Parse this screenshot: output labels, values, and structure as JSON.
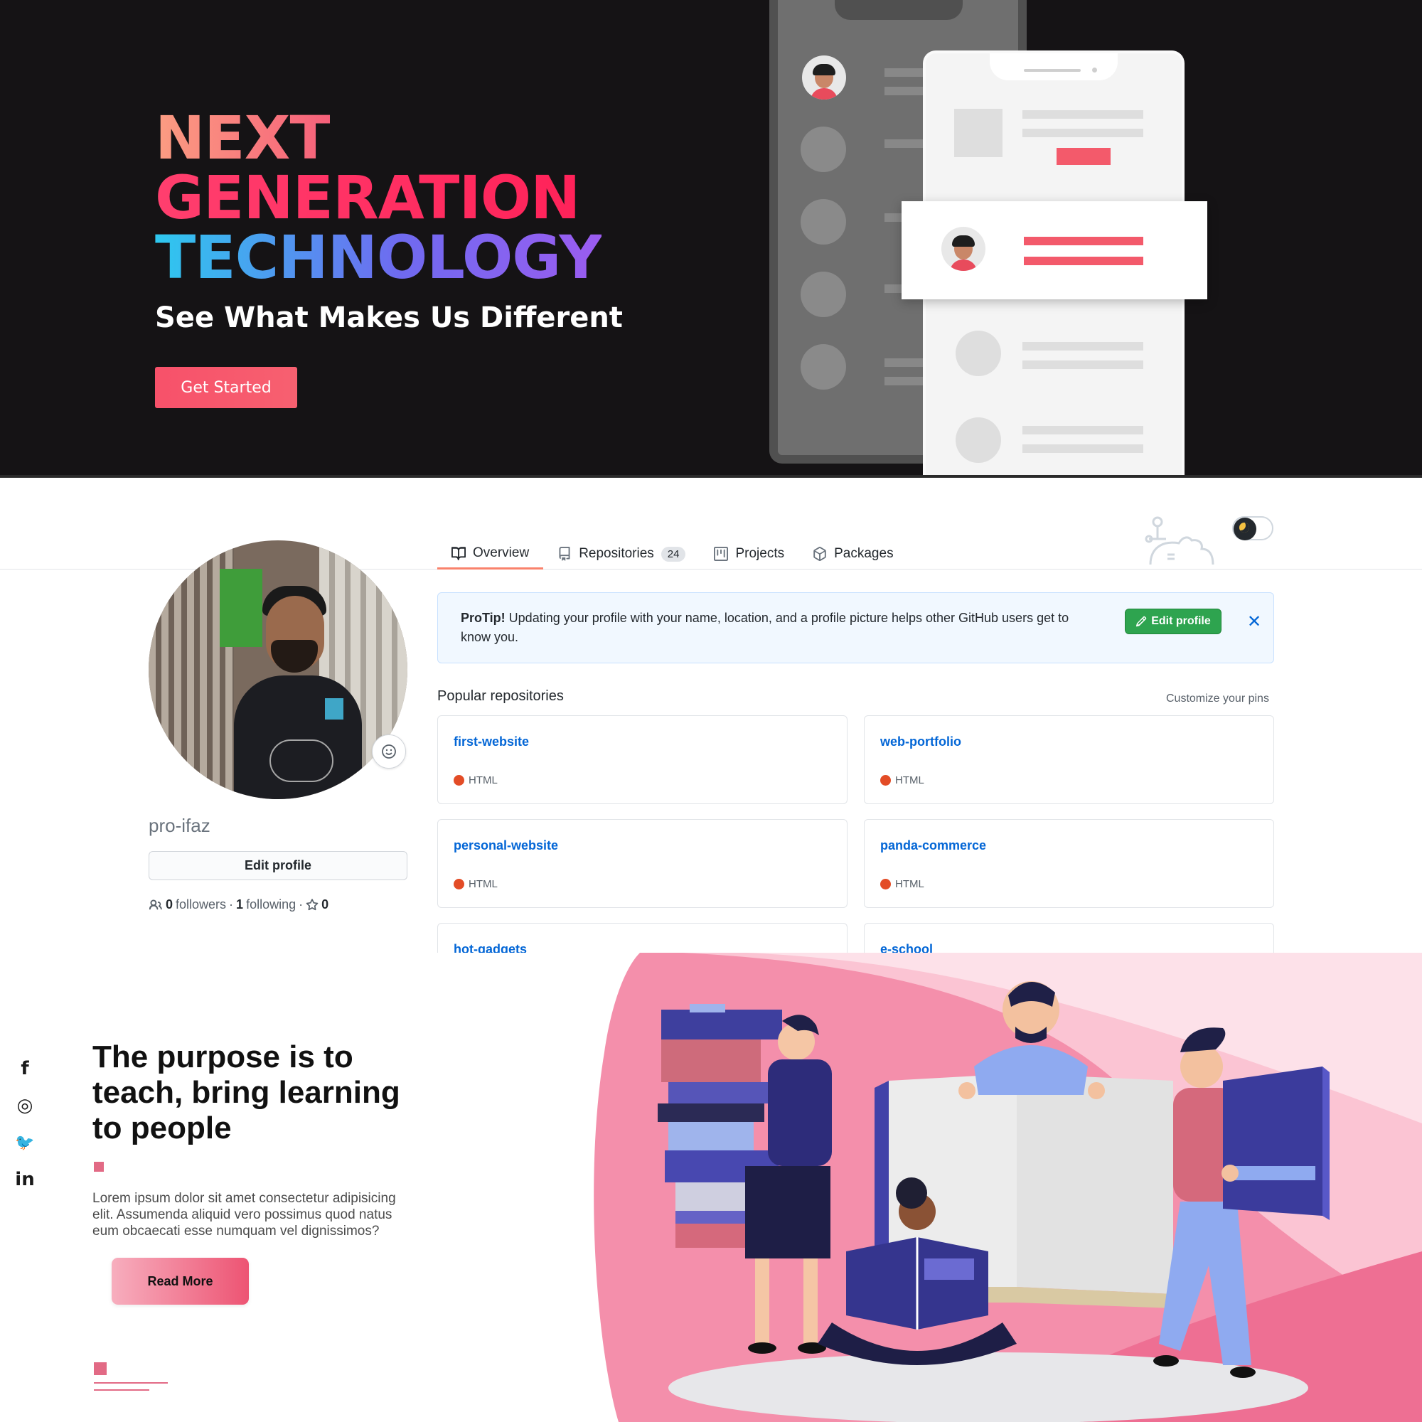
{
  "hero": {
    "title_line_1": "NEXT",
    "title_line_2": "GENERATION",
    "title_line_3": "TECHNOLOGY",
    "subtitle": "See What Makes Us Different",
    "cta_label": "Get Started",
    "background_color": "#151315",
    "accent_color": "#f7516a"
  },
  "github": {
    "tabs": [
      {
        "label": "Overview",
        "icon": "book-icon",
        "active": true
      },
      {
        "label": "Repositories",
        "icon": "repo-icon",
        "count": "24"
      },
      {
        "label": "Projects",
        "icon": "project-icon"
      },
      {
        "label": "Packages",
        "icon": "package-icon"
      }
    ],
    "username": "pro-ifaz",
    "edit_profile_label": "Edit profile",
    "followers_count": "0",
    "followers_label": "followers",
    "following_count": "1",
    "following_label": "following",
    "stars_count": "0",
    "protip": {
      "bold": "ProTip!",
      "text": " Updating your profile with your name, location, and a profile picture helps other GitHub users get to know you.",
      "button_label": "Edit profile",
      "close_label": "✕"
    },
    "popular_title": "Popular repositories",
    "customize_label": "Customize your pins",
    "repos": [
      {
        "name": "first-website",
        "language": "HTML"
      },
      {
        "name": "web-portfolio",
        "language": "HTML"
      },
      {
        "name": "personal-website",
        "language": "HTML"
      },
      {
        "name": "panda-commerce",
        "language": "HTML"
      },
      {
        "name": "hot-gadgets",
        "language": ""
      },
      {
        "name": "e-school",
        "language": ""
      }
    ],
    "language_color": "#e34c26",
    "link_color": "#0366d6",
    "success_color": "#2ea44f"
  },
  "education": {
    "social": [
      {
        "label": "f",
        "icon": "facebook-icon"
      },
      {
        "label": "◎",
        "icon": "instagram-icon"
      },
      {
        "label": "🐦",
        "icon": "twitter-icon"
      },
      {
        "label": "in",
        "icon": "linkedin-icon"
      }
    ],
    "title": "The purpose is to teach, bring learning to people",
    "text": "Lorem ipsum dolor sit amet consectetur adipisicing elit. Assumenda aliquid vero possimus quod natus eum obcaecati esse numquam vel dignissimos?",
    "cta_label": "Read More",
    "accent_color": "#e26a85"
  }
}
